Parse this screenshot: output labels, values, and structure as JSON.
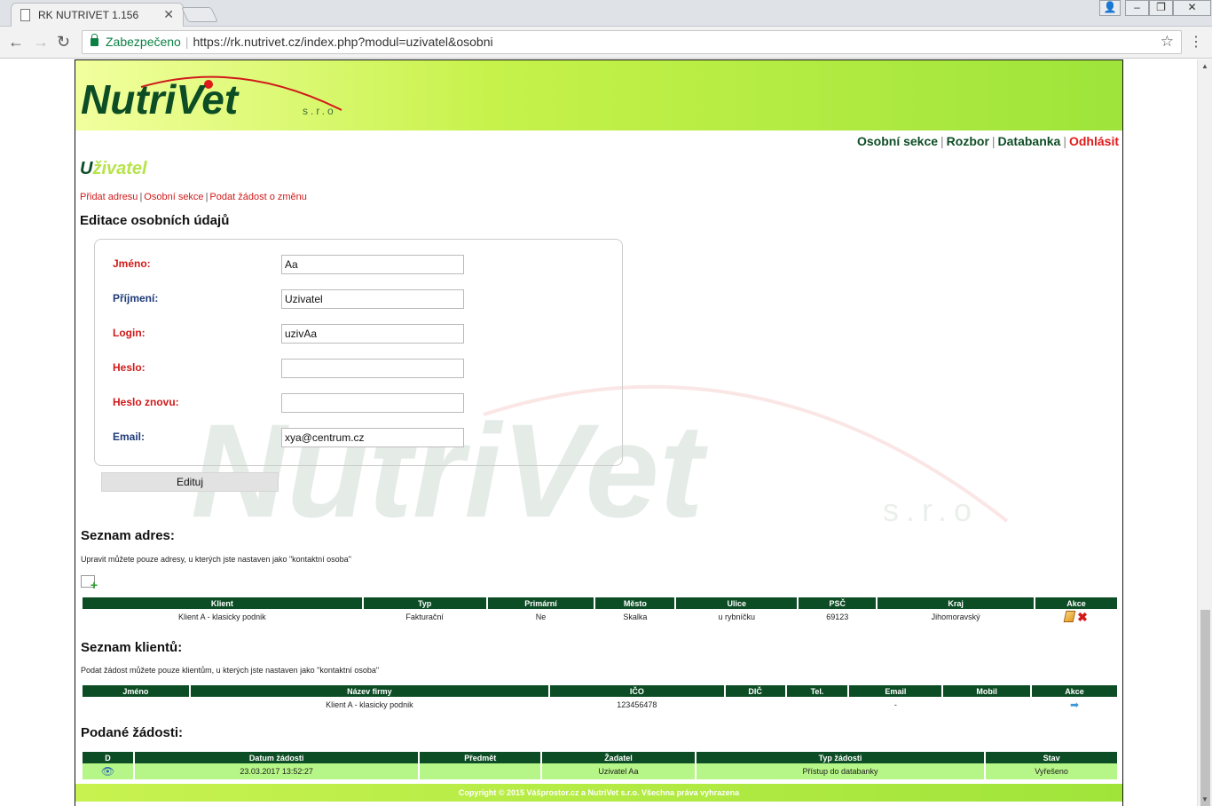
{
  "browser": {
    "tab_title": "RK NUTRIVET 1.156",
    "secure_label": "Zabezpečeno",
    "url": "https://rk.nutrivet.cz/index.php?modul=uzivatel&osobni"
  },
  "header": {
    "logo_text": "NutriVet",
    "logo_suffix": "s.r.o"
  },
  "topnav": {
    "osobni": "Osobní sekce",
    "rozbor": "Rozbor",
    "databanka": "Databanka",
    "odhlasit": "Odhlásit"
  },
  "page_title_first": "U",
  "page_title_rest": "živatel",
  "sublinks": {
    "pridat": "Přidat adresu",
    "osobni": "Osobní sekce",
    "zadost": "Podat žádost o změnu"
  },
  "edit_heading": "Editace osobních údajů",
  "form": {
    "fields": [
      {
        "label": "Jméno:",
        "value": "Aa"
      },
      {
        "label": "Příjmení:",
        "value": "Uzivatel"
      },
      {
        "label": "Login:",
        "value": "uzivAa"
      },
      {
        "label": "Heslo:",
        "value": ""
      },
      {
        "label": "Heslo znovu:",
        "value": ""
      },
      {
        "label": "Email:",
        "value": "xya@centrum.cz"
      }
    ],
    "submit": "Edituj"
  },
  "colors": {
    "dark_green": "#0d4d25",
    "red": "#d01a1a",
    "label_blue": "#1e3a78",
    "light_green": "#b6f587"
  },
  "addresses": {
    "heading": "Seznam adres:",
    "note": "Upravit můžete pouze adresy, u kterých jste nastaven jako \"kontaktní osoba\"",
    "add_icon": "add-address-icon",
    "columns": [
      "Klient",
      "Typ",
      "Primární",
      "Město",
      "Ulice",
      "PSČ",
      "Kraj",
      "Akce"
    ],
    "rows": [
      [
        "Klient A - klasicky podnik",
        "Fakturační",
        "Ne",
        "Skalka",
        "u rybníčku",
        "69123",
        "Jihomoravský"
      ]
    ]
  },
  "clients": {
    "heading": "Seznam klientů:",
    "note": "Podat žádost můžete pouze klientům, u kterých jste nastaven jako \"kontaktní osoba\"",
    "columns": [
      "Jméno",
      "Název firmy",
      "IČO",
      "DIČ",
      "Tel.",
      "Email",
      "Mobil",
      "Akce"
    ],
    "rows": [
      [
        "",
        "Klient A - klasicky podnik",
        "123456478",
        "",
        "",
        "-",
        ""
      ]
    ]
  },
  "requests": {
    "heading": "Podané žádosti:",
    "columns": [
      "D",
      "Datum žádosti",
      "Předmět",
      "Žadatel",
      "Typ žádosti",
      "Stav"
    ],
    "rows": [
      [
        "23.03.2017 13:52:27",
        "",
        "Uzivatel Aa",
        "Přístup do databanky",
        "Vyřešeno"
      ]
    ]
  },
  "footer": "Copyright © 2015 Vášprostor.cz a NutriVet s.r.o. Všechna práva vyhrazena"
}
